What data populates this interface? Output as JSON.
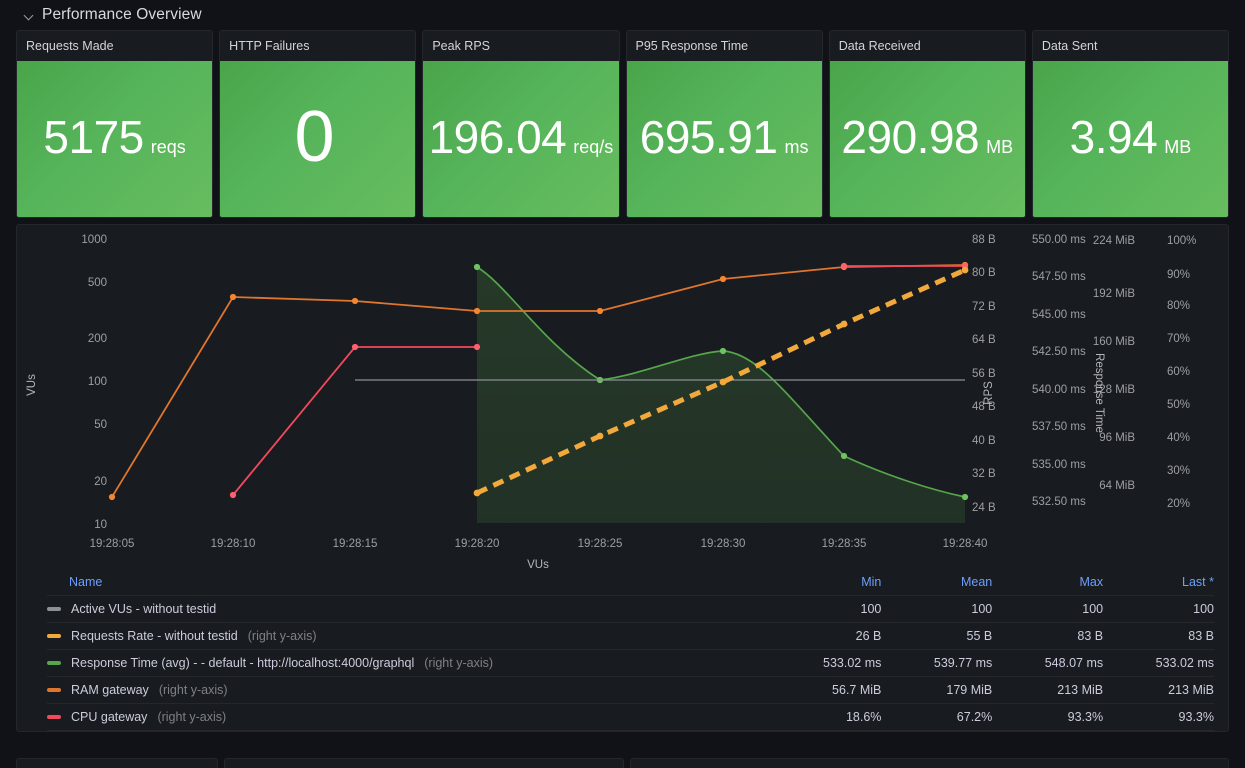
{
  "row": {
    "title": "Performance Overview",
    "collapse_icon": "chevron-down-icon",
    "expanded": true
  },
  "stats": [
    {
      "title": "Requests Made",
      "value": "5175",
      "unit": "reqs",
      "color": "#56b45a",
      "big": false
    },
    {
      "title": "HTTP Failures",
      "value": "0",
      "unit": "",
      "color": "#56b45a",
      "big": true
    },
    {
      "title": "Peak RPS",
      "value": "196.04",
      "unit": "req/s",
      "color": "#56b45a",
      "big": false
    },
    {
      "title": "P95 Response Time",
      "value": "695.91",
      "unit": "ms",
      "color": "#56b45a",
      "big": false
    },
    {
      "title": "Data Received",
      "value": "290.98",
      "unit": "MB",
      "color": "#56b45a",
      "big": false
    },
    {
      "title": "Data Sent",
      "value": "3.94",
      "unit": "MB",
      "color": "#56b45a",
      "big": false
    }
  ],
  "chart_data": {
    "type": "line",
    "title": "",
    "xlabel": "VUs",
    "x_ticks": [
      "19:28:05",
      "19:28:10",
      "19:28:15",
      "19:28:20",
      "19:28:25",
      "19:28:30",
      "19:28:35",
      "19:28:40"
    ],
    "grid": false,
    "legend_position": "bottom-table",
    "axes": [
      {
        "id": "left-vus",
        "name": "VUs",
        "side": "left",
        "scale": "log",
        "ticks": [
          "10",
          "20",
          "50",
          "100",
          "200",
          "500",
          "1000"
        ],
        "range": [
          10,
          1000
        ]
      },
      {
        "id": "right-bytes",
        "name": "",
        "side": "right",
        "scale": "linear",
        "ticks": [
          "24 B",
          "32 B",
          "40 B",
          "48 B",
          "56 B",
          "64 B",
          "72 B",
          "80 B",
          "88 B"
        ],
        "range": [
          24,
          88
        ]
      },
      {
        "id": "right-rps",
        "name": "RPS",
        "side": "right",
        "scale": "linear",
        "ticks": [
          "532.50 ms",
          "535.00 ms",
          "537.50 ms",
          "540.00 ms",
          "542.50 ms",
          "545.00 ms",
          "547.50 ms",
          "550.00 ms"
        ],
        "range": [
          532.5,
          550.0
        ]
      },
      {
        "id": "right-resptime",
        "name": "Response Time",
        "side": "right",
        "scale": "linear",
        "ticks": [
          "64 MiB",
          "96 MiB",
          "128 MiB",
          "160 MiB",
          "192 MiB",
          "224 MiB"
        ],
        "range": [
          64,
          224
        ]
      },
      {
        "id": "right-pct",
        "name": "",
        "side": "right",
        "scale": "linear",
        "ticks": [
          "20%",
          "30%",
          "40%",
          "50%",
          "60%",
          "70%",
          "80%",
          "90%",
          "100%"
        ],
        "range": [
          20,
          100
        ]
      }
    ],
    "series": [
      {
        "name": "Active VUs - without testid",
        "color": "#8e9097",
        "style": "solid",
        "axis": "left-vus",
        "x": [
          "19:28:15",
          "19:28:40"
        ],
        "values": [
          100,
          100
        ]
      },
      {
        "name": "Requests Rate - without testid",
        "color": "#f2a93b",
        "style": "dashed",
        "axis": "right-bytes",
        "x": [
          "19:28:20",
          "19:28:25",
          "19:28:30",
          "19:28:35",
          "19:28:40"
        ],
        "values": [
          26,
          40,
          55,
          69,
          83
        ]
      },
      {
        "name": "Response Time (avg) - - default - http://localhost:4000/graphql",
        "color": "#56a64b",
        "style": "area",
        "axis": "right-rps",
        "x": [
          "19:28:20",
          "19:28:25",
          "19:28:30",
          "19:28:35",
          "19:28:40"
        ],
        "values": [
          548.07,
          539.5,
          541.3,
          536.0,
          533.02
        ]
      },
      {
        "name": "RAM gateway",
        "color": "#e0752d",
        "style": "solid",
        "axis": "right-resptime",
        "x": [
          "19:28:05",
          "19:28:10",
          "19:28:15",
          "19:28:20",
          "19:28:25",
          "19:28:30",
          "19:28:35",
          "19:28:40"
        ],
        "values": [
          56.7,
          179,
          181,
          176,
          176,
          206,
          213,
          213
        ]
      },
      {
        "name": "CPU gateway",
        "color": "#f2495c",
        "style": "solid",
        "axis": "right-pct",
        "x": [
          "19:28:10",
          "19:28:15",
          "19:28:20",
          "19:28:35",
          "19:28:40"
        ],
        "values": [
          18.6,
          67.2,
          67.2,
          93.3,
          93.3
        ]
      }
    ]
  },
  "legend": {
    "columns": [
      "Name",
      "Min",
      "Mean",
      "Max",
      "Last *"
    ],
    "rows": [
      {
        "swatch": "#8e9097",
        "label": "Active VUs - without testid",
        "sub": "",
        "min": "100",
        "mean": "100",
        "max": "100",
        "last": "100"
      },
      {
        "swatch": "#f2a93b",
        "label": "Requests Rate - without testid",
        "sub": "(right y-axis)",
        "min": "26 B",
        "mean": "55 B",
        "max": "83 B",
        "last": "83 B"
      },
      {
        "swatch": "#56a64b",
        "label": "Response Time (avg) - - default - http://localhost:4000/graphql",
        "sub": "(right y-axis)",
        "min": "533.02 ms",
        "mean": "539.77 ms",
        "max": "548.07 ms",
        "last": "533.02 ms"
      },
      {
        "swatch": "#e0752d",
        "label": "RAM gateway",
        "sub": "(right y-axis)",
        "min": "56.7 MiB",
        "mean": "179 MiB",
        "max": "213 MiB",
        "last": "213 MiB"
      },
      {
        "swatch": "#f2495c",
        "label": "CPU gateway",
        "sub": "(right y-axis)",
        "min": "18.6%",
        "mean": "67.2%",
        "max": "93.3%",
        "last": "93.3%"
      }
    ]
  }
}
